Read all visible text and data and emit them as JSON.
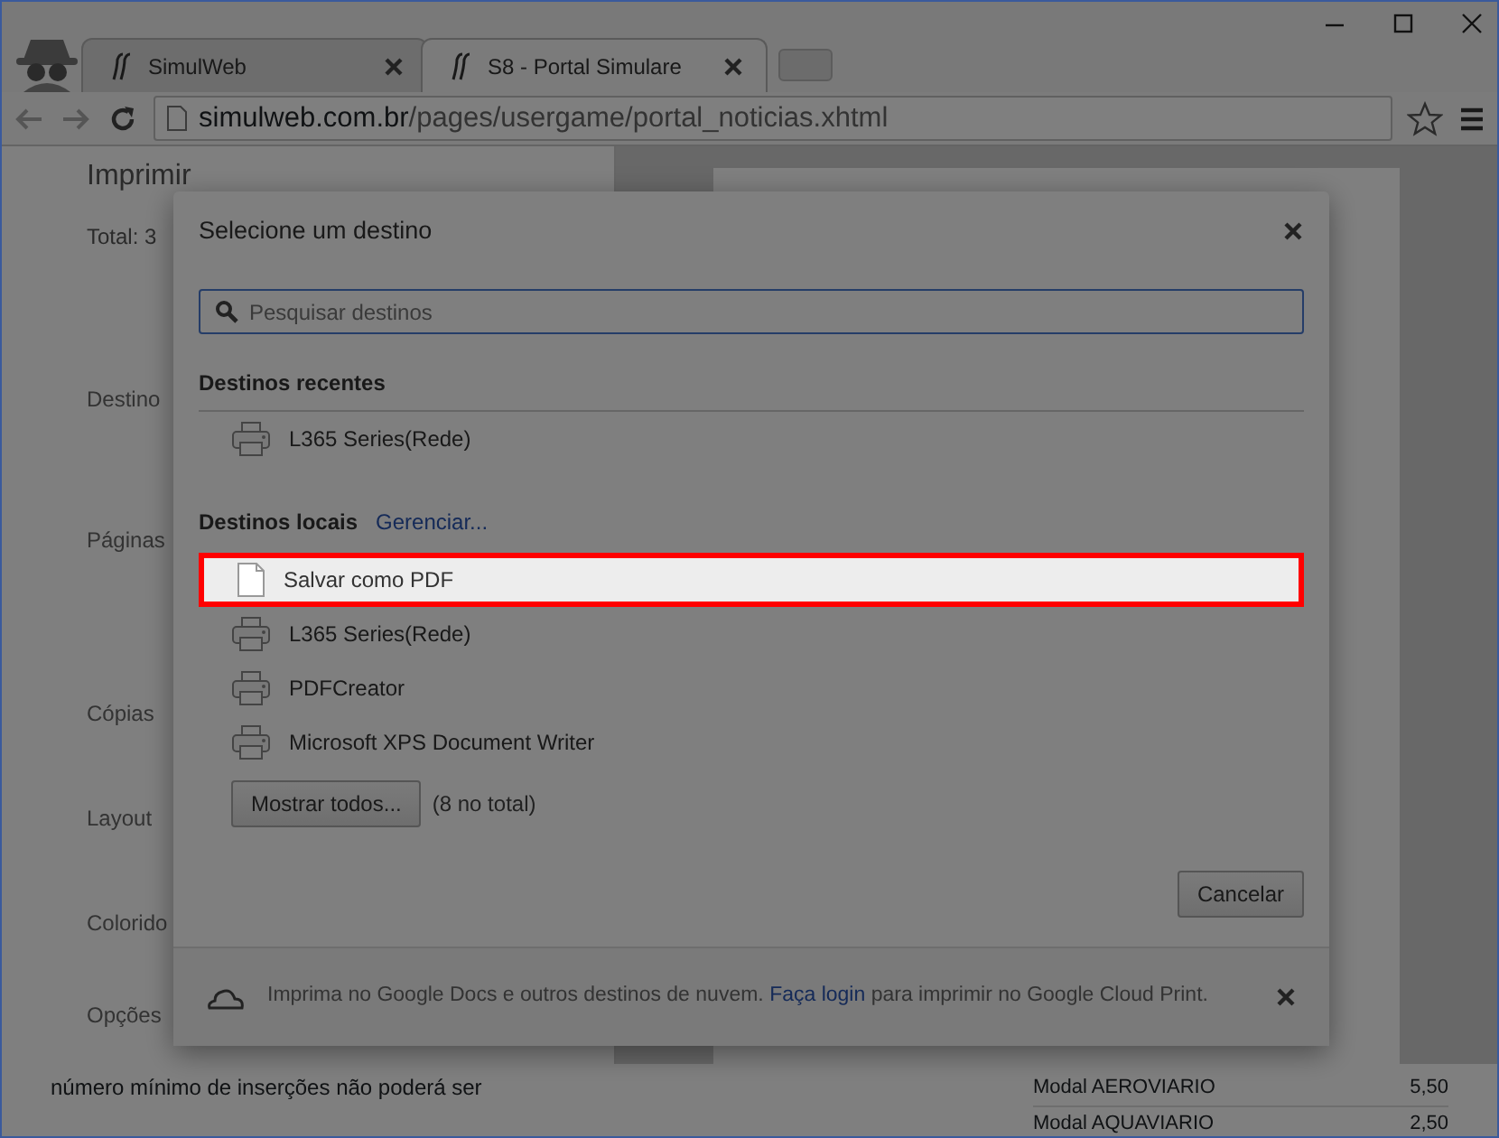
{
  "browser": {
    "tabs": [
      {
        "title": "SimulWeb",
        "selected": false
      },
      {
        "title": "S8 - Portal Simulare",
        "selected": true
      }
    ],
    "address": {
      "host": "simulweb.com.br",
      "path": "/pages/usergame/portal_noticias.xhtml"
    }
  },
  "print_sidebar": {
    "title": "Imprimir",
    "total": "Total: 3",
    "settings": [
      "Destino",
      "Páginas",
      "Cópias",
      "Layout",
      "Colorido",
      "Opções"
    ]
  },
  "page_text": {
    "paragraph": "número mínimo de inserções não poderá ser",
    "table_rows": [
      {
        "label": "Modal AEROVIARIO",
        "value": "5,50"
      },
      {
        "label": "Modal AQUAVIARIO",
        "value": "2,50"
      }
    ]
  },
  "dialog": {
    "title": "Selecione um destino",
    "search": {
      "placeholder": "Pesquisar destinos"
    },
    "recent": {
      "heading": "Destinos recentes",
      "destinations": [
        {
          "name": "L365 Series(Rede)",
          "kind": "printer",
          "highlighted": false
        }
      ]
    },
    "local": {
      "heading": "Destinos locais",
      "link": "Gerenciar...",
      "destinations": [
        {
          "name": "Salvar como PDF",
          "kind": "pdf",
          "highlighted": true
        },
        {
          "name": "L365 Series(Rede)",
          "kind": "printer",
          "highlighted": false
        },
        {
          "name": "PDFCreator",
          "kind": "printer",
          "highlighted": false
        },
        {
          "name": "Microsoft XPS Document Writer",
          "kind": "printer",
          "highlighted": false
        }
      ]
    },
    "show_all_button": "Mostrar todos...",
    "total": "(8 no total)",
    "cancel_button": "Cancelar",
    "cloud_notice": {
      "text": "Imprima no Google Docs e outros destinos de nuvem.",
      "link": "Faça login",
      "text_after": "para imprimir no Google Cloud Print."
    }
  }
}
